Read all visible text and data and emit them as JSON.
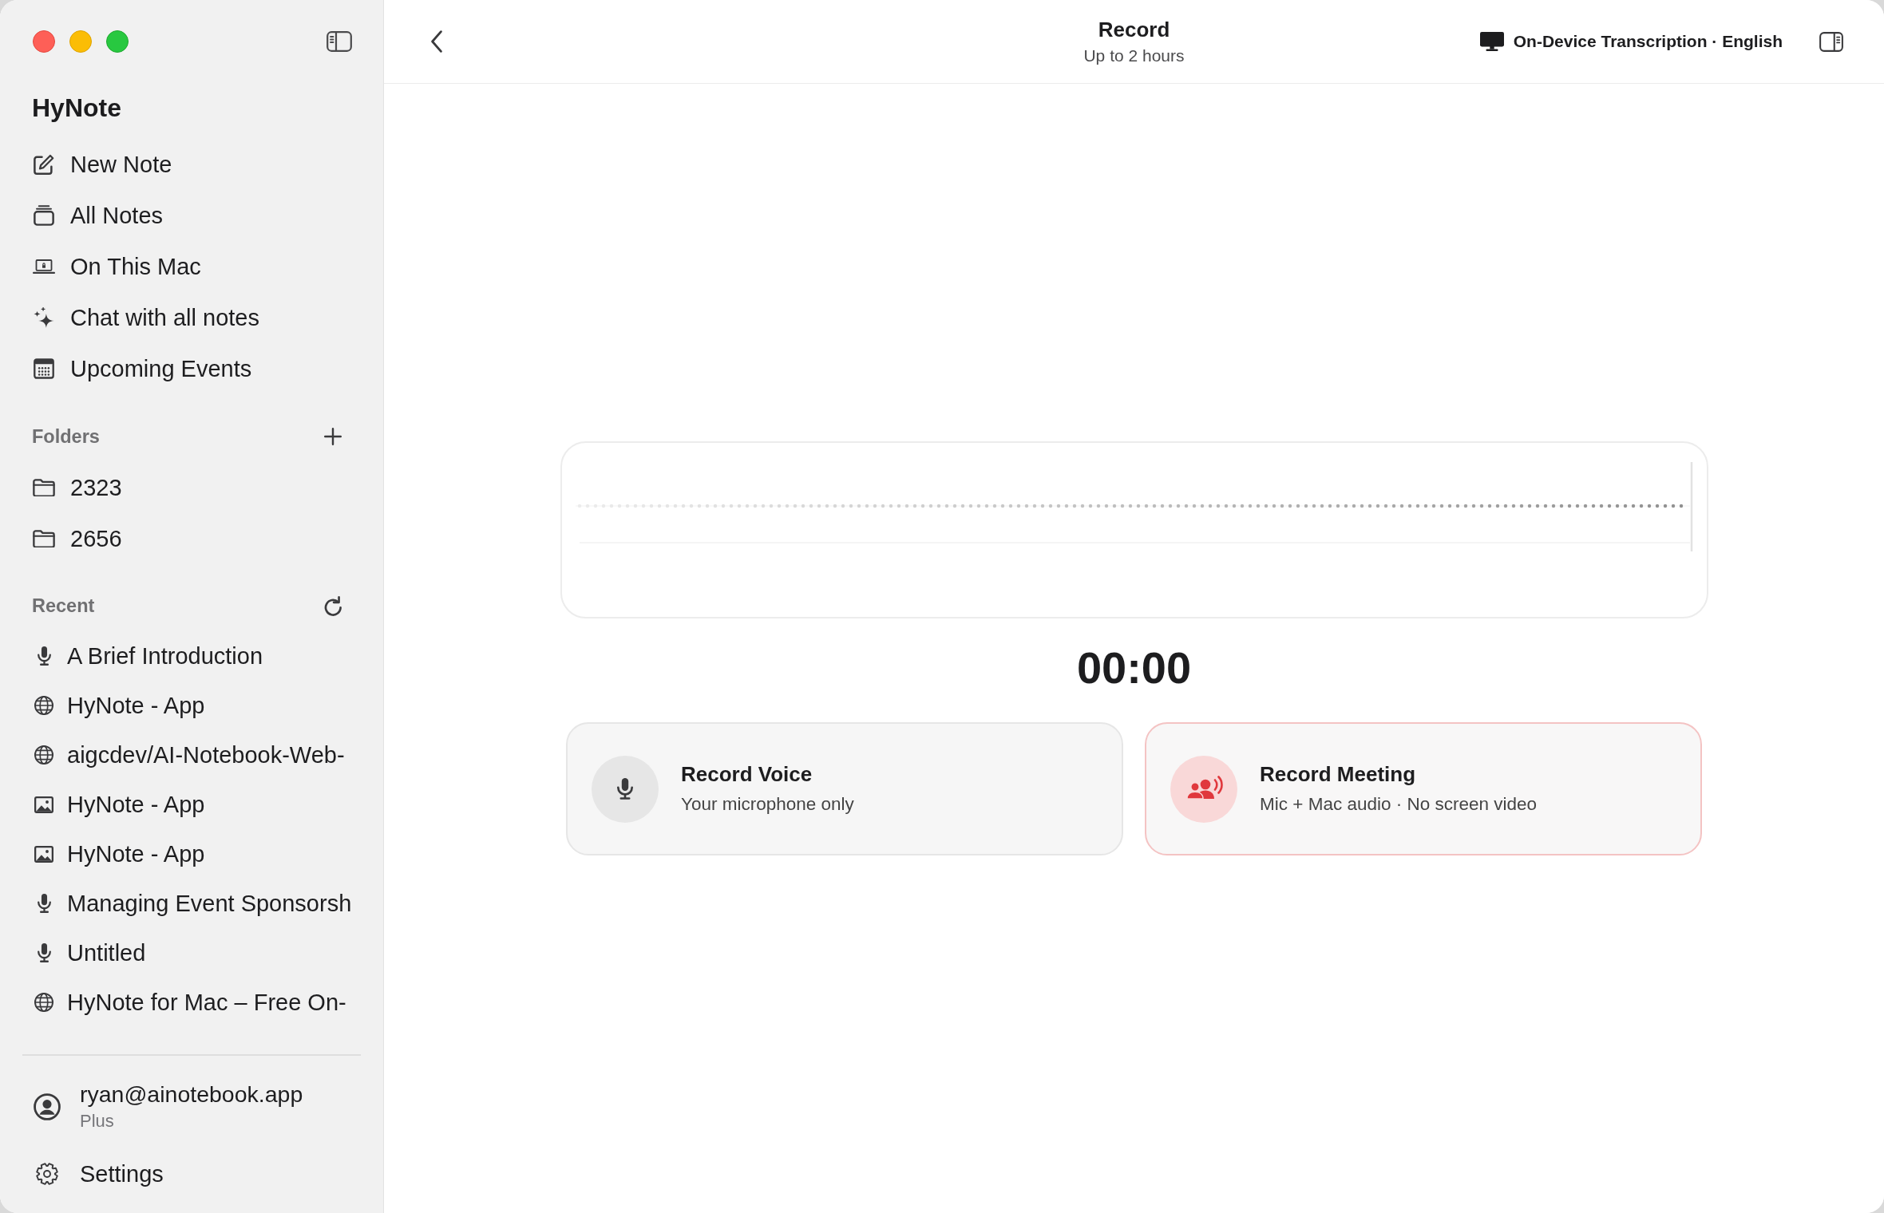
{
  "sidebar": {
    "app_name": "HyNote",
    "nav_items": [
      {
        "label": "New Note"
      },
      {
        "label": "All Notes"
      },
      {
        "label": "On This Mac"
      },
      {
        "label": "Chat with all notes"
      },
      {
        "label": "Upcoming Events"
      }
    ],
    "folders": {
      "title": "Folders",
      "items": [
        {
          "label": "2323"
        },
        {
          "label": "2656"
        }
      ]
    },
    "recent": {
      "title": "Recent",
      "items": [
        {
          "kind": "voice",
          "label": "A Brief Introduction"
        },
        {
          "kind": "web",
          "label": "HyNote - App"
        },
        {
          "kind": "web",
          "label": "aigcdev/AI-Notebook-Web-"
        },
        {
          "kind": "image",
          "label": "HyNote - App"
        },
        {
          "kind": "image",
          "label": "HyNote - App"
        },
        {
          "kind": "voice",
          "label": "Managing Event Sponsorsh"
        },
        {
          "kind": "voice",
          "label": "Untitled"
        },
        {
          "kind": "web",
          "label": "HyNote for Mac – Free On-"
        }
      ]
    },
    "account": {
      "email": "ryan@ainotebook.app",
      "plan": "Plus"
    },
    "settings": {
      "label": "Settings"
    }
  },
  "header": {
    "title": "Record",
    "subtitle": "Up to 2 hours",
    "transcription": "On-Device Transcription · English"
  },
  "recorder": {
    "timer": "00:00",
    "modes": [
      {
        "kind": "voice",
        "title": "Record Voice",
        "subtitle": "Your microphone only",
        "selected": false
      },
      {
        "kind": "meeting",
        "title": "Record Meeting",
        "subtitle": "Mic + Mac audio · No screen video",
        "selected": true
      }
    ]
  }
}
